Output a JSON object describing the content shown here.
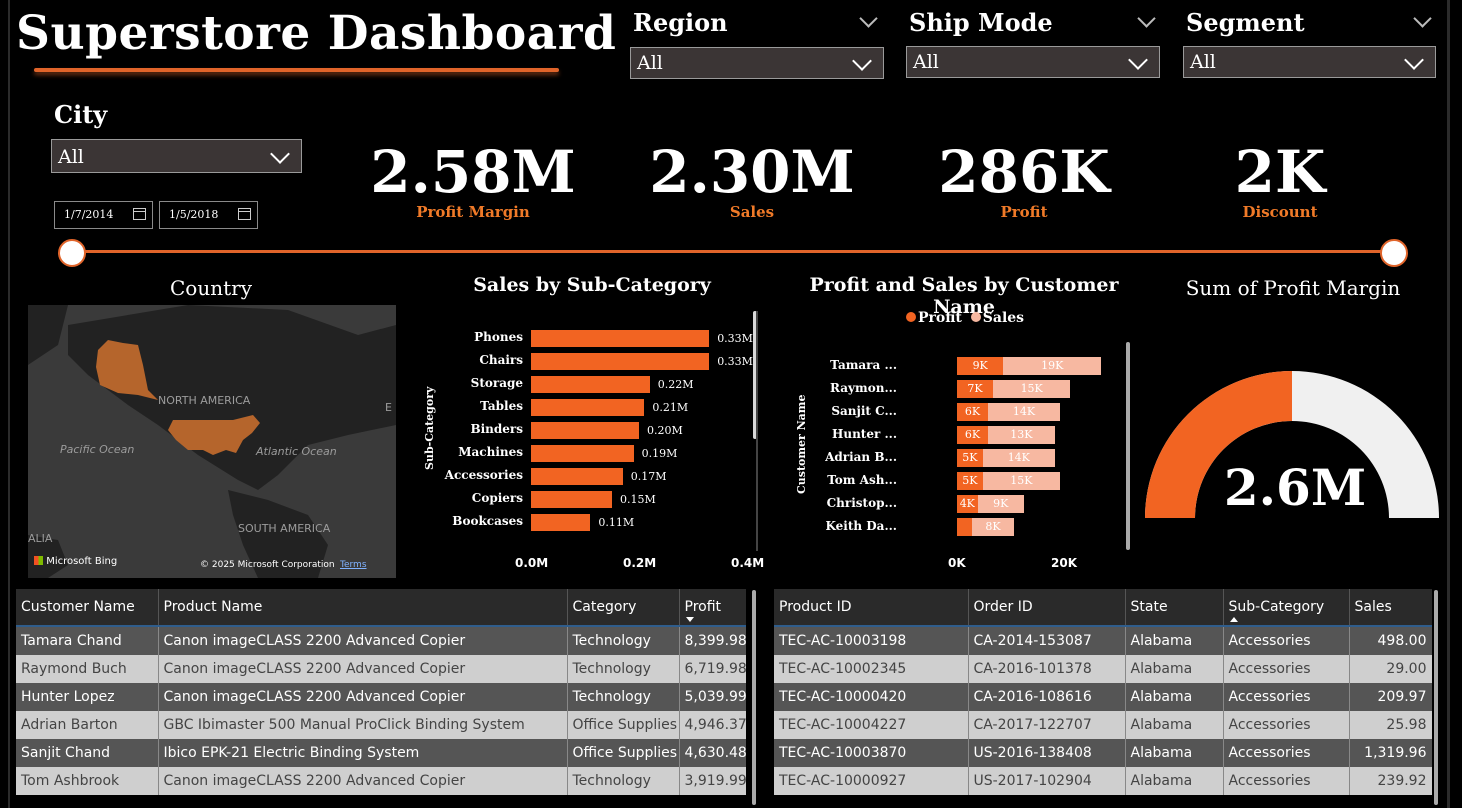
{
  "title": "Superstore Dashboard",
  "slicers": {
    "region": {
      "label": "Region",
      "value": "All"
    },
    "ship_mode": {
      "label": "Ship Mode",
      "value": "All"
    },
    "segment": {
      "label": "Segment",
      "value": "All"
    },
    "city": {
      "label": "City",
      "value": "All"
    },
    "date_start": "1/7/2014",
    "date_end": "1/5/2018"
  },
  "kpis": [
    {
      "value": "2.58M",
      "label": "Profit Margin"
    },
    {
      "value": "2.30M",
      "label": "Sales"
    },
    {
      "value": "286K",
      "label": "Profit"
    },
    {
      "value": "2K",
      "label": "Discount"
    }
  ],
  "map": {
    "title": "Country",
    "labels": {
      "north_america": "NORTH AMERICA",
      "pacific": "Pacific Ocean",
      "atlantic": "Atlantic Ocean",
      "south_america": "SOUTH AMERICA",
      "edge_left": "ALIA",
      "edge_right": "E"
    },
    "attribution": "Microsoft Bing",
    "copyright": "© 2025 Microsoft Corporation",
    "terms": "Terms",
    "highlight_color": "#b5652c"
  },
  "chart_data": [
    {
      "type": "bar",
      "title": "Sales by Sub-Category",
      "ylabel": "Sub-Category",
      "categories": [
        "Phones",
        "Chairs",
        "Storage",
        "Tables",
        "Binders",
        "Machines",
        "Accessories",
        "Copiers",
        "Bookcases"
      ],
      "values": [
        0.33,
        0.33,
        0.22,
        0.21,
        0.2,
        0.19,
        0.17,
        0.15,
        0.11
      ],
      "value_labels": [
        "0.33M",
        "0.33M",
        "0.22M",
        "0.21M",
        "0.20M",
        "0.19M",
        "0.17M",
        "0.15M",
        "0.11M"
      ],
      "xticks": [
        "0.0M",
        "0.2M",
        "0.4M"
      ],
      "xlim": [
        0,
        0.4
      ],
      "color": "#f26422"
    },
    {
      "type": "bar",
      "title": "Profit and Sales by Customer Name",
      "ylabel": "Customer Name",
      "legend": [
        "Profit",
        "Sales"
      ],
      "categories": [
        "Tamara ...",
        "Raymon...",
        "Sanjit C...",
        "Hunter ...",
        "Adrian B...",
        "Tom Ash...",
        "Christop...",
        "Keith Da..."
      ],
      "series": [
        {
          "name": "Profit",
          "values": [
            9,
            7,
            6,
            6,
            5,
            5,
            4,
            3
          ],
          "labels": [
            "9K",
            "7K",
            "6K",
            "6K",
            "5K",
            "5K",
            "4K",
            ""
          ],
          "color": "#f26422"
        },
        {
          "name": "Sales",
          "values": [
            19,
            15,
            14,
            13,
            14,
            15,
            9,
            8
          ],
          "labels": [
            "19K",
            "15K",
            "14K",
            "13K",
            "14K",
            "15K",
            "9K",
            "8K"
          ],
          "color": "#f7b8a1"
        }
      ],
      "xticks": [
        "0K",
        "20K"
      ],
      "xlim": [
        0,
        29
      ]
    },
    {
      "type": "gauge",
      "title": "Sum of Profit Margin",
      "value_label": "2.6M",
      "fill_fraction": 0.5,
      "fill_color": "#f26422",
      "track_color": "#f0f0f0"
    }
  ],
  "table_left": {
    "columns": [
      "Customer Name",
      "Product Name",
      "Category",
      "Profit"
    ],
    "rows": [
      [
        "Tamara Chand",
        "Canon imageCLASS 2200 Advanced Copier",
        "Technology",
        "8,399.98"
      ],
      [
        "Raymond Buch",
        "Canon imageCLASS 2200 Advanced Copier",
        "Technology",
        "6,719.98"
      ],
      [
        "Hunter Lopez",
        "Canon imageCLASS 2200 Advanced Copier",
        "Technology",
        "5,039.99"
      ],
      [
        "Adrian Barton",
        "GBC Ibimaster 500 Manual ProClick Binding System",
        "Office Supplies",
        "4,946.37"
      ],
      [
        "Sanjit Chand",
        "Ibico EPK-21 Electric Binding System",
        "Office Supplies",
        "4,630.48"
      ],
      [
        "Tom Ashbrook",
        "Canon imageCLASS 2200 Advanced Copier",
        "Technology",
        "3,919.99"
      ]
    ]
  },
  "table_right": {
    "columns": [
      "Product ID",
      "Order ID",
      "State",
      "Sub-Category",
      "Sales"
    ],
    "rows": [
      [
        "TEC-AC-10003198",
        "CA-2014-153087",
        "Alabama",
        "Accessories",
        "498.00"
      ],
      [
        "TEC-AC-10002345",
        "CA-2016-101378",
        "Alabama",
        "Accessories",
        "29.00"
      ],
      [
        "TEC-AC-10000420",
        "CA-2016-108616",
        "Alabama",
        "Accessories",
        "209.97"
      ],
      [
        "TEC-AC-10004227",
        "CA-2017-122707",
        "Alabama",
        "Accessories",
        "25.98"
      ],
      [
        "TEC-AC-10003870",
        "US-2016-138408",
        "Alabama",
        "Accessories",
        "1,319.96"
      ],
      [
        "TEC-AC-10000927",
        "US-2017-102904",
        "Alabama",
        "Accessories",
        "239.92"
      ]
    ]
  }
}
